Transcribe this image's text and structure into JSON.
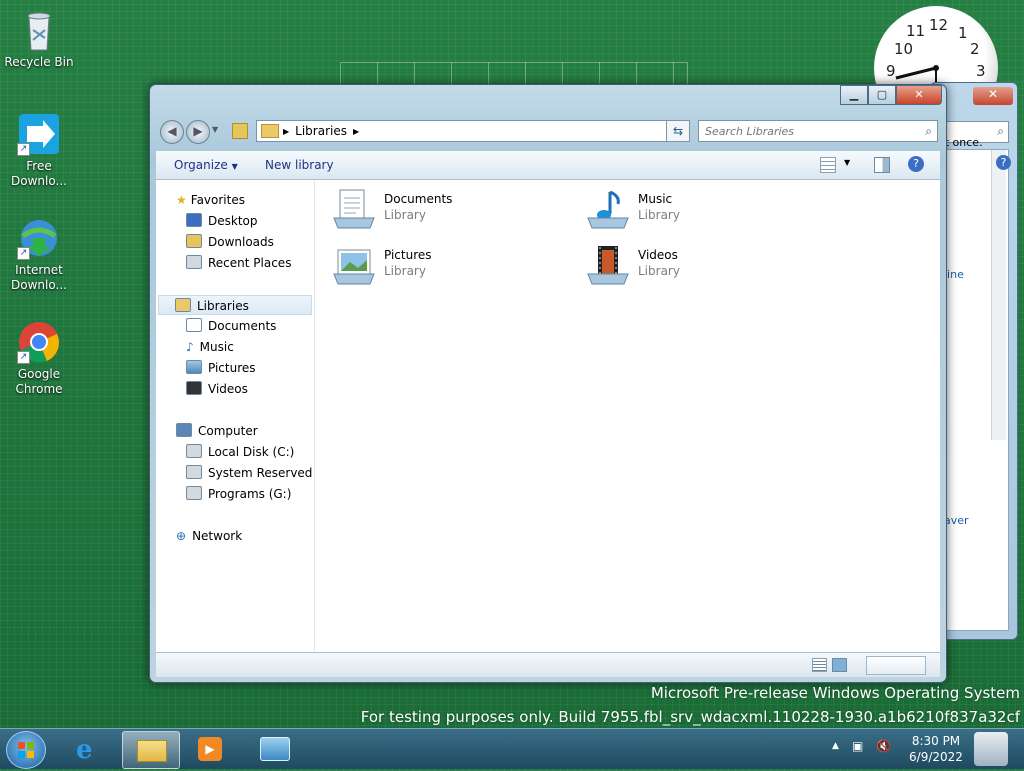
{
  "desktop": {
    "icons": [
      {
        "label": "Recycle Bin"
      },
      {
        "label": "Free Downlo..."
      },
      {
        "label": "Internet Downlo..."
      },
      {
        "label": "Google Chrome"
      }
    ]
  },
  "clock": {
    "numbers": [
      "12",
      "1",
      "2",
      "3",
      "9",
      "10",
      "11"
    ],
    "time_hour": 8,
    "time_minute": 30
  },
  "back_window": {
    "fragments": [
      "at once.",
      "line",
      "aver"
    ],
    "close": "✕"
  },
  "explorer": {
    "address": {
      "crumbs": [
        "Libraries"
      ]
    },
    "search": {
      "placeholder": "Search Libraries"
    },
    "toolbar": {
      "organize": "Organize",
      "new_library": "New library"
    },
    "nav": {
      "favorites": "Favorites",
      "favorite_items": [
        "Desktop",
        "Downloads",
        "Recent Places"
      ],
      "libraries": "Libraries",
      "library_items": [
        "Documents",
        "Music",
        "Pictures",
        "Videos"
      ],
      "computer": "Computer",
      "drives": [
        "Local Disk (C:)",
        "System Reserved (D:",
        "Programs (G:)"
      ],
      "network": "Network"
    },
    "items": [
      {
        "name": "Documents",
        "type": "Library"
      },
      {
        "name": "Music",
        "type": "Library"
      },
      {
        "name": "Pictures",
        "type": "Library"
      },
      {
        "name": "Videos",
        "type": "Library"
      }
    ]
  },
  "watermark": {
    "line1": "Microsoft Pre-release Windows Operating System",
    "line2": "For testing purposes only. Build 7955.fbl_srv_wdacxml.110228-1930.a1b6210f837a32cf"
  },
  "taskbar": {
    "time": "8:30 PM",
    "date": "6/9/2022"
  },
  "colors": {
    "desktop": "#1f7a3e",
    "link": "#1e3287",
    "close": "#c8442a"
  }
}
